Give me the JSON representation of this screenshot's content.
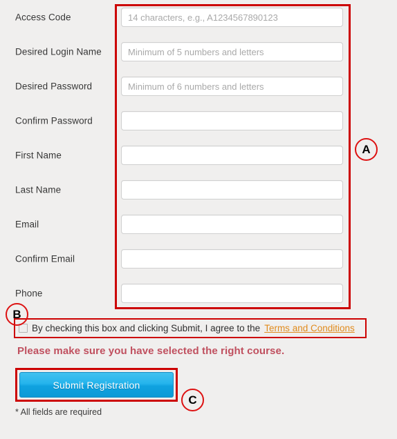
{
  "form": {
    "fields": [
      {
        "label": "Access Code",
        "placeholder": "14 characters, e.g., A1234567890123",
        "value": ""
      },
      {
        "label": "Desired Login Name",
        "placeholder": "Minimum of 5 numbers and letters",
        "value": ""
      },
      {
        "label": "Desired Password",
        "placeholder": "Minimum of 6 numbers and letters",
        "value": ""
      },
      {
        "label": "Confirm Password",
        "placeholder": "",
        "value": ""
      },
      {
        "label": "First Name",
        "placeholder": "",
        "value": ""
      },
      {
        "label": "Last Name",
        "placeholder": "",
        "value": ""
      },
      {
        "label": "Email",
        "placeholder": "",
        "value": ""
      },
      {
        "label": "Confirm Email",
        "placeholder": "",
        "value": ""
      },
      {
        "label": "Phone",
        "placeholder": "",
        "value": ""
      }
    ]
  },
  "terms": {
    "text": "By checking this box and clicking Submit, I agree to the",
    "link_label": "Terms and Conditions",
    "checked": false
  },
  "warning": {
    "text": "Please make sure you have selected the right course."
  },
  "submit": {
    "label": "Submit Registration"
  },
  "footnote": {
    "text": "* All fields are required"
  },
  "annotations": [
    {
      "id": "A",
      "label": "A"
    },
    {
      "id": "B",
      "label": "B"
    },
    {
      "id": "C",
      "label": "C"
    }
  ],
  "colors": {
    "annotation_red": "#cc0000",
    "annotation_circle_red": "#dd1111",
    "link_orange": "#e08b1c",
    "warning_crimson": "#c0505f",
    "submit_blue_top": "#3fc1f0",
    "submit_blue_bottom": "#0d9ad6",
    "page_background": "#f0efee",
    "label_text": "#373737",
    "input_border": "#cfcfcf",
    "placeholder": "#a9a9a9"
  }
}
